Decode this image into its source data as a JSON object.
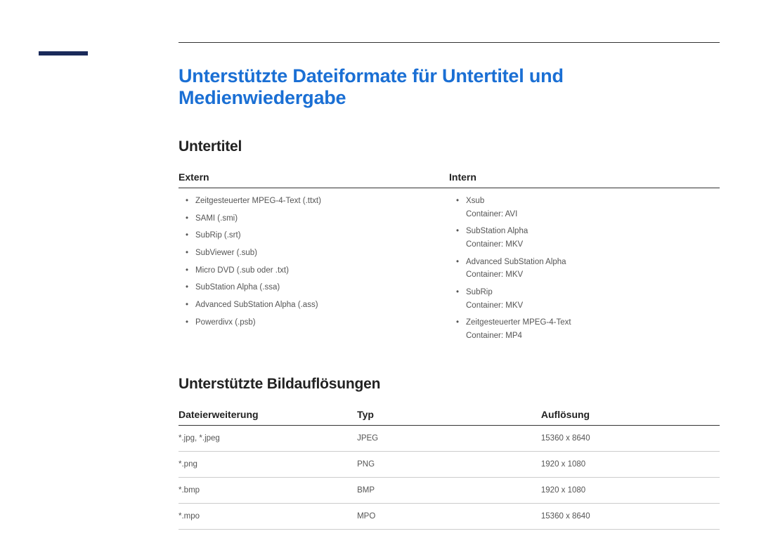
{
  "page_title": "Unterstützte Dateiformate für Untertitel und Medienwiedergabe",
  "section_subtitles": {
    "heading": "Untertitel",
    "columns": {
      "extern": "Extern",
      "intern": "Intern"
    },
    "extern_list": [
      {
        "name": "Zeitgesteuerter MPEG-4-Text (.ttxt)"
      },
      {
        "name": "SAMI (.smi)"
      },
      {
        "name": "SubRip (.srt)"
      },
      {
        "name": "SubViewer (.sub)"
      },
      {
        "name": "Micro DVD (.sub oder .txt)"
      },
      {
        "name": "SubStation Alpha (.ssa)"
      },
      {
        "name": "Advanced SubStation Alpha (.ass)"
      },
      {
        "name": "Powerdivx (.psb)"
      }
    ],
    "intern_list": [
      {
        "name": "Xsub",
        "container": "Container: AVI"
      },
      {
        "name": "SubStation Alpha",
        "container": "Container: MKV"
      },
      {
        "name": "Advanced SubStation Alpha",
        "container": "Container: MKV"
      },
      {
        "name": "SubRip",
        "container": "Container: MKV"
      },
      {
        "name": "Zeitgesteuerter MPEG-4-Text",
        "container": "Container: MP4"
      }
    ]
  },
  "section_resolutions": {
    "heading": "Unterstützte Bildauflösungen",
    "columns": {
      "ext": "Dateierweiterung",
      "type": "Typ",
      "res": "Auflösung"
    },
    "rows": [
      {
        "ext": "*.jpg, *.jpeg",
        "type": "JPEG",
        "res": "15360 x 8640"
      },
      {
        "ext": "*.png",
        "type": "PNG",
        "res": "1920 x 1080"
      },
      {
        "ext": "*.bmp",
        "type": "BMP",
        "res": "1920 x 1080"
      },
      {
        "ext": "*.mpo",
        "type": "MPO",
        "res": "15360 x 8640"
      }
    ]
  }
}
